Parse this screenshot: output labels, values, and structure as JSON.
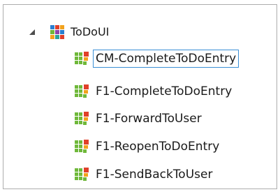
{
  "tree": {
    "root": {
      "label": "ToDoUI",
      "icon": "grid-module-icon",
      "expanded": true
    },
    "children": [
      {
        "label": "CM-CompleteToDoEntry",
        "icon": "grid-flow-icon",
        "selected": true
      },
      {
        "label": "F1-CompleteToDoEntry",
        "icon": "grid-flow-icon",
        "selected": false
      },
      {
        "label": "F1-ForwardToUser",
        "icon": "grid-flow-icon",
        "selected": false
      },
      {
        "label": "F1-ReopenToDoEntry",
        "icon": "grid-flow-icon",
        "selected": false
      },
      {
        "label": "F1-SendBackToUser",
        "icon": "grid-flow-icon",
        "selected": false
      }
    ]
  },
  "colors": {
    "selection_border": "#3a8fd6",
    "green": "#6fb83a",
    "orange": "#f2a21d",
    "red": "#e0402a",
    "blue": "#2b7fd1",
    "purple": "#8e44ad",
    "teal": "#2aa39a"
  }
}
